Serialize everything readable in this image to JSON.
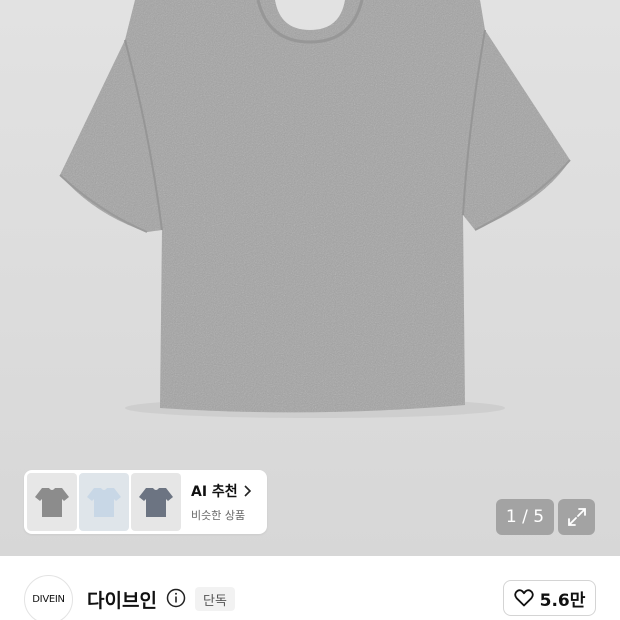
{
  "product": {
    "image_description_icon": "gray-tshirt-image",
    "counter": "1 / 5"
  },
  "ai_recommend": {
    "title": "AI 추천",
    "subtitle": "비슷한 상품",
    "thumbnails": [
      {
        "icon": "gray-tshirt-thumb",
        "color": "#8c8c8c"
      },
      {
        "icon": "lightblue-tshirt-thumb",
        "color": "#c8d7e6"
      },
      {
        "icon": "navy-tshirt-thumb",
        "color": "#6c7482"
      }
    ]
  },
  "brand": {
    "logo_text": "DIVEIN",
    "name": "다이브인",
    "badge": "단독"
  },
  "like": {
    "count": "5.6만"
  },
  "colors": {
    "shirt": "#a4a4a4",
    "background": "#dddddd"
  }
}
